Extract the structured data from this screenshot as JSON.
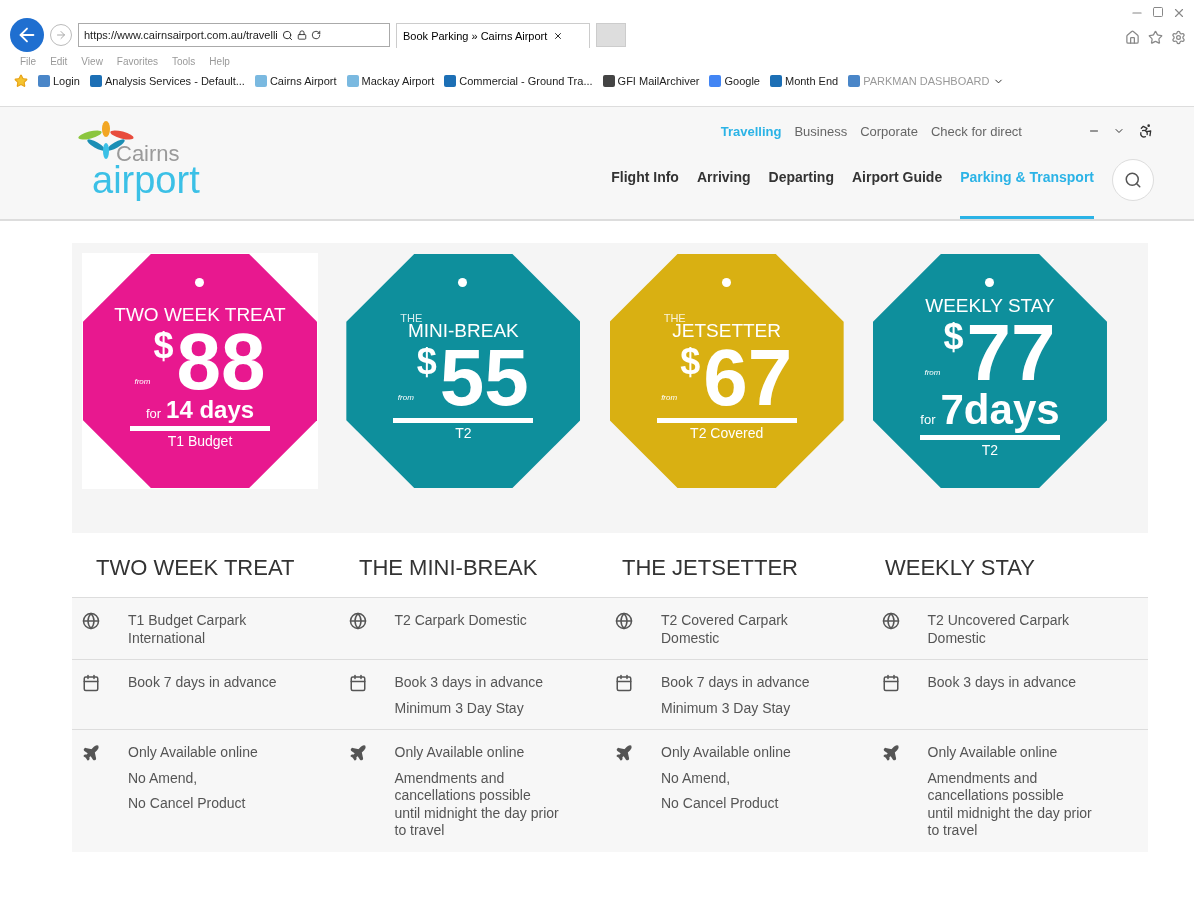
{
  "browser": {
    "url": "https://www.cairnsairport.com.au/travelli",
    "tab_title": "Book Parking » Cairns Airport",
    "menu": [
      "File",
      "Edit",
      "View",
      "Favorites",
      "Tools",
      "Help"
    ],
    "favorites": [
      {
        "label": "Login",
        "kind": "page"
      },
      {
        "label": "Analysis Services - Default...",
        "kind": "sharepoint"
      },
      {
        "label": "Cairns Airport",
        "kind": "site"
      },
      {
        "label": "Mackay Airport",
        "kind": "site"
      },
      {
        "label": "Commercial - Ground Tra...",
        "kind": "sharepoint"
      },
      {
        "label": "GFI MailArchiver",
        "kind": "archive"
      },
      {
        "label": "Google",
        "kind": "google"
      },
      {
        "label": "Month End",
        "kind": "sharepoint"
      },
      {
        "label": "PARKMAN DASHBOARD",
        "kind": "page",
        "dropdown": true
      }
    ]
  },
  "site": {
    "logo": {
      "small": "Cairns",
      "large": "airport"
    },
    "top_links": [
      {
        "label": "Travelling",
        "selected": true
      },
      {
        "label": "Business",
        "selected": false
      },
      {
        "label": "Corporate",
        "selected": false
      },
      {
        "label": "Check for direct",
        "selected": false
      }
    ],
    "nav": [
      {
        "label": "Flight Info",
        "selected": false
      },
      {
        "label": "Arriving",
        "selected": false
      },
      {
        "label": "Departing",
        "selected": false
      },
      {
        "label": "Airport Guide",
        "selected": false
      },
      {
        "label": "Parking & Transport",
        "selected": true
      }
    ]
  },
  "deals": [
    {
      "color": "#e8188f",
      "boxed": true,
      "title": "TWO WEEK TREAT",
      "currency": "$",
      "price": "88",
      "from": "from",
      "for": "for",
      "days": "14 days",
      "terminal": "T1 Budget"
    },
    {
      "color": "#0e8f9c",
      "boxed": false,
      "pre": "THE",
      "title": "MINI-BREAK",
      "currency": "$",
      "price": "55",
      "from": "from",
      "terminal": "T2"
    },
    {
      "color": "#d9b012",
      "boxed": false,
      "pre": "THE",
      "title": "JETSETTER",
      "currency": "$",
      "price": "67",
      "from": "from",
      "terminal": "T2 Covered"
    },
    {
      "color": "#0e8f9c",
      "boxed": false,
      "title": "WEEKLY STAY",
      "currency": "$",
      "price": "77",
      "from": "from",
      "for": "for",
      "days": "7days",
      "terminal": "T2"
    }
  ],
  "table": {
    "columns": [
      "TWO WEEK TREAT",
      "THE MINI-BREAK",
      "THE JETSETTER",
      "WEEKLY STAY"
    ],
    "rows": [
      {
        "kind": "location",
        "cells": [
          [
            "T1 Budget Carpark International"
          ],
          [
            "T2 Carpark Domestic"
          ],
          [
            "T2 Covered Carpark Domestic"
          ],
          [
            "T2 Uncovered Carpark Domestic"
          ]
        ]
      },
      {
        "kind": "calendar",
        "cells": [
          [
            "Book 7 days in advance"
          ],
          [
            "Book 3 days in advance",
            "Minimum 3 Day Stay"
          ],
          [
            "Book 7 days in advance",
            "Minimum 3 Day Stay"
          ],
          [
            "Book 3 days in advance"
          ]
        ]
      },
      {
        "kind": "plane",
        "cells": [
          [
            "Only Available online",
            "No Amend,",
            "No Cancel Product"
          ],
          [
            "Only Available online",
            "Amendments and cancellations possible until midnight the day prior to travel"
          ],
          [
            "Only Available online",
            "No Amend,",
            "No Cancel Product"
          ],
          [
            "Only Available online",
            "Amendments and cancellations possible until midnight the day prior to travel"
          ]
        ]
      }
    ]
  }
}
